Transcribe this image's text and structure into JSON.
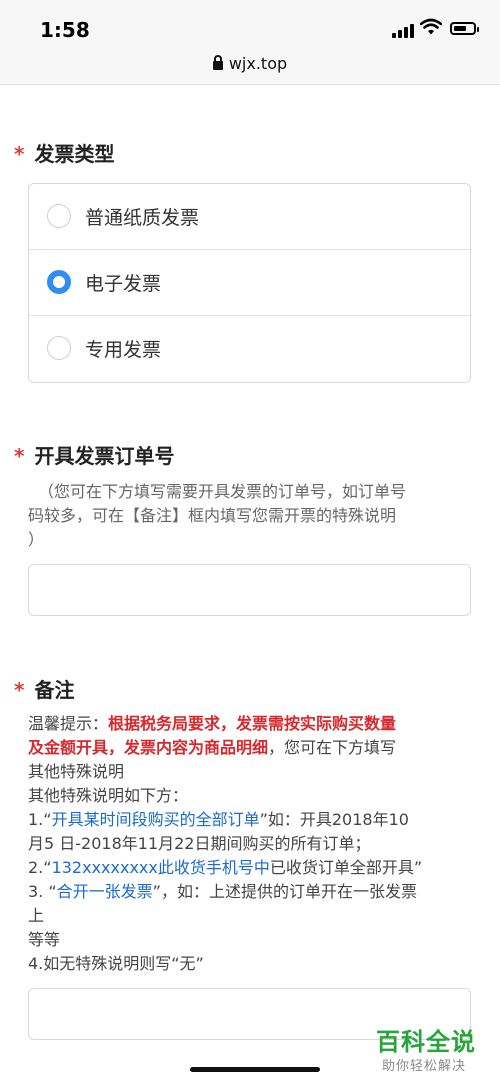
{
  "status_bar": {
    "time": "1:58"
  },
  "browser": {
    "url": "wjx.top"
  },
  "questions": [
    {
      "required_mark": "*",
      "title": "发票类型",
      "options": [
        {
          "label": "普通纸质发票",
          "selected": false
        },
        {
          "label": "电子发票",
          "selected": true
        },
        {
          "label": "专用发票",
          "selected": false
        }
      ]
    },
    {
      "required_mark": "*",
      "title": "开具发票订单号",
      "hint_lines": [
        "（您可在下方填写需要开具发票的订单号，如订单号",
        "码较多，可在【备注】框内填写您需开票的特殊说明",
        "）"
      ],
      "input_value": ""
    },
    {
      "required_mark": "*",
      "title": "备注",
      "notes": {
        "l1_a": "温馨提示：",
        "l1_b": "根据税务局要求，发票需按实际购买数量",
        "l2_a": "及金额开具，发票内容为商品明细",
        "l2_b": "，您可在下方填写",
        "l3": "其他特殊说明",
        "l4": "其他特殊说明如下方：",
        "l5_a": "1.“",
        "l5_b": "开具某时间段购买的全部订单",
        "l5_c": "”如：开具2018年10",
        "l6": "月5 日-2018年11月22日期间购买的所有订单；",
        "l7_a": "2.“",
        "l7_b": "132xxxxxxxx此收货手机号中",
        "l7_c": "已收货订单全部开具”",
        "l8_a": "3. “",
        "l8_b": "合开一张发票",
        "l8_c": "”，如：上述提供的订单开在一张发票",
        "l9": "上",
        "l10": "等等",
        "l11": "4.如无特殊说明则写“无”"
      },
      "input_value": ""
    }
  ],
  "watermark": {
    "title": "百科全说",
    "subtitle": "助你轻松解决"
  },
  "colors": {
    "required": "#e53935",
    "radio_checked": "#2f8ef0",
    "warning": "#d8282d",
    "link": "#1a6ad1",
    "watermark": "#27a53a"
  }
}
